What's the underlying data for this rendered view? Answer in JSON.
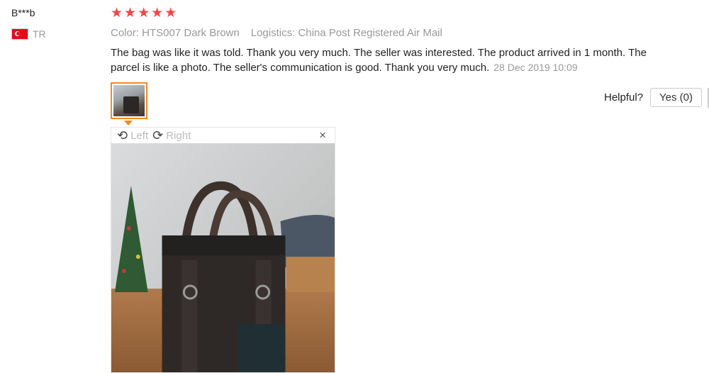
{
  "reviewer": {
    "name": "B***b",
    "country_code": "TR"
  },
  "rating": {
    "stars": 5,
    "star_glyph": "★",
    "star_color": "#f04646"
  },
  "order": {
    "color": "Color: HTS007 Dark Brown",
    "logistics": "Logistics: China Post Registered Air Mail"
  },
  "review": {
    "text": "The bag was like it was told. Thank you very much. The seller was interested. The product arrived in 1 month. The parcel is like a photo. The seller's communication is good. Thank you very much.",
    "date": "28 Dec 2019 10:09"
  },
  "viewer": {
    "rotate_left_label": "Left",
    "rotate_right_label": "Right",
    "close_glyph": "×"
  },
  "helpful": {
    "label": "Helpful?",
    "yes_label": "Yes (0)"
  },
  "colors": {
    "accent": "#f08a24"
  }
}
